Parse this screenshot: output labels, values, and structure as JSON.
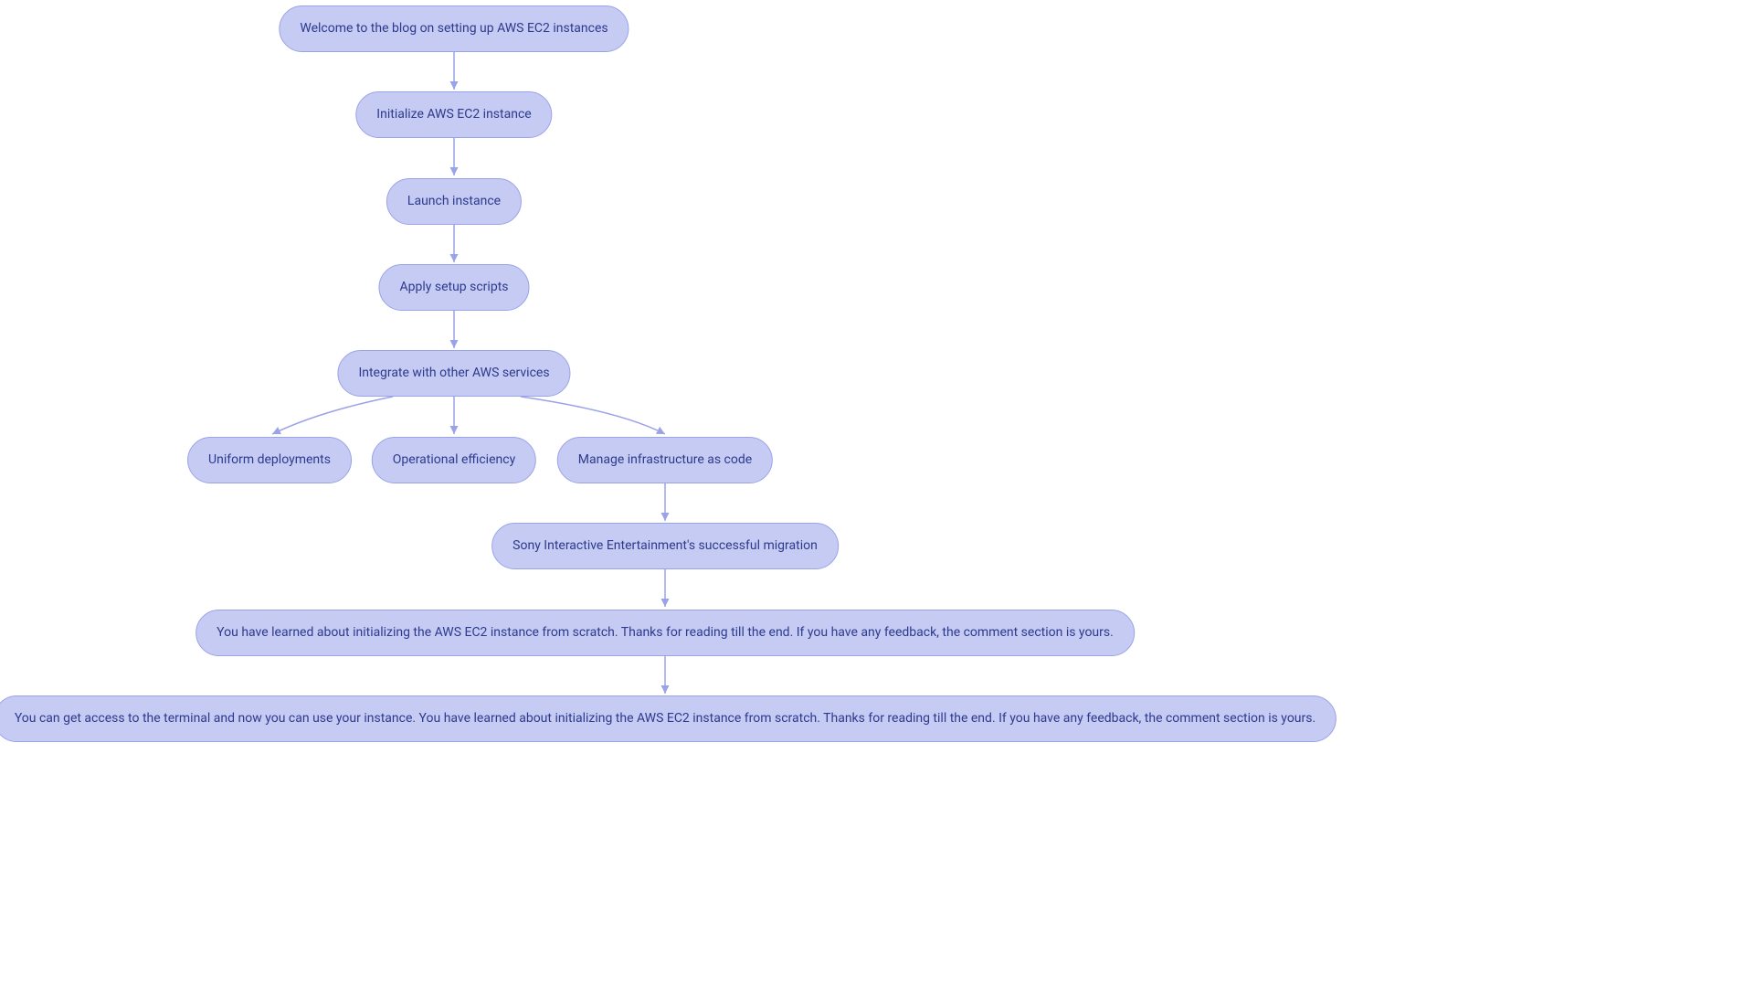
{
  "colors": {
    "node_fill": "#c6cbf4",
    "node_border": "#9aa3e8",
    "text": "#2d3a8c",
    "arrow": "#9aa3e8"
  },
  "nodes": {
    "welcome": "Welcome to the blog on setting up AWS EC2 instances",
    "init": "Initialize AWS EC2 instance",
    "launch": "Launch instance",
    "apply": "Apply setup scripts",
    "integrate": "Integrate with other AWS services",
    "uniform": "Uniform deployments",
    "opeff": "Operational efficiency",
    "iac": "Manage infrastructure as code",
    "sony": "Sony Interactive Entertainment's successful migration",
    "learned": "You have learned about initializing the AWS EC2 instance from scratch. Thanks for reading till the end. If you have any feedback, the comment section is yours.",
    "terminal": "You can get access to the terminal and now you can use your instance. You have learned about initializing the AWS EC2 instance from scratch. Thanks for reading till the end. If you have any feedback, the comment section is yours."
  }
}
